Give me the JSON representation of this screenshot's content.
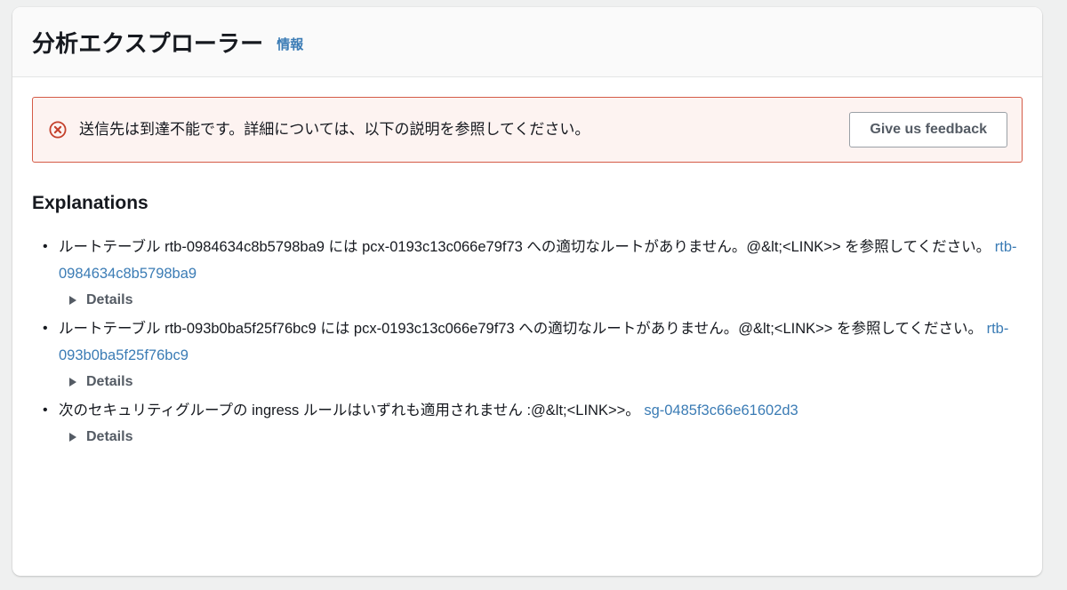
{
  "header": {
    "title": "分析エクスプローラー",
    "info_link": "情報"
  },
  "alert": {
    "icon": "error-circle-x-icon",
    "message": "送信先は到達不能です。詳細については、以下の説明を参照してください。",
    "feedback_button": "Give us feedback",
    "background_color": "#fdf3f1",
    "border_color": "#d45b47",
    "icon_color": "#c4402b"
  },
  "explanations": {
    "heading": "Explanations",
    "details_label": "Details",
    "link_color": "#3b7cb5",
    "items": [
      {
        "text_before": "ルートテーブル rtb-0984634c8b5798ba9 には pcx-0193c13c066e79f73 への適切なルートがありません。@&lt;<LINK>> を参照してください。 ",
        "link": "rtb-0984634c8b5798ba9",
        "details": "Details"
      },
      {
        "text_before": "ルートテーブル rtb-093b0ba5f25f76bc9 には pcx-0193c13c066e79f73 への適切なルートがありません。@&lt;<LINK>> を参照してください。 ",
        "link": "rtb-093b0ba5f25f76bc9",
        "details": "Details"
      },
      {
        "text_before": "次のセキュリティグループの ingress ルールはいずれも適用されません :@&lt;<LINK>>。 ",
        "link": "sg-0485f3c66e61602d3",
        "details": "Details"
      }
    ]
  }
}
